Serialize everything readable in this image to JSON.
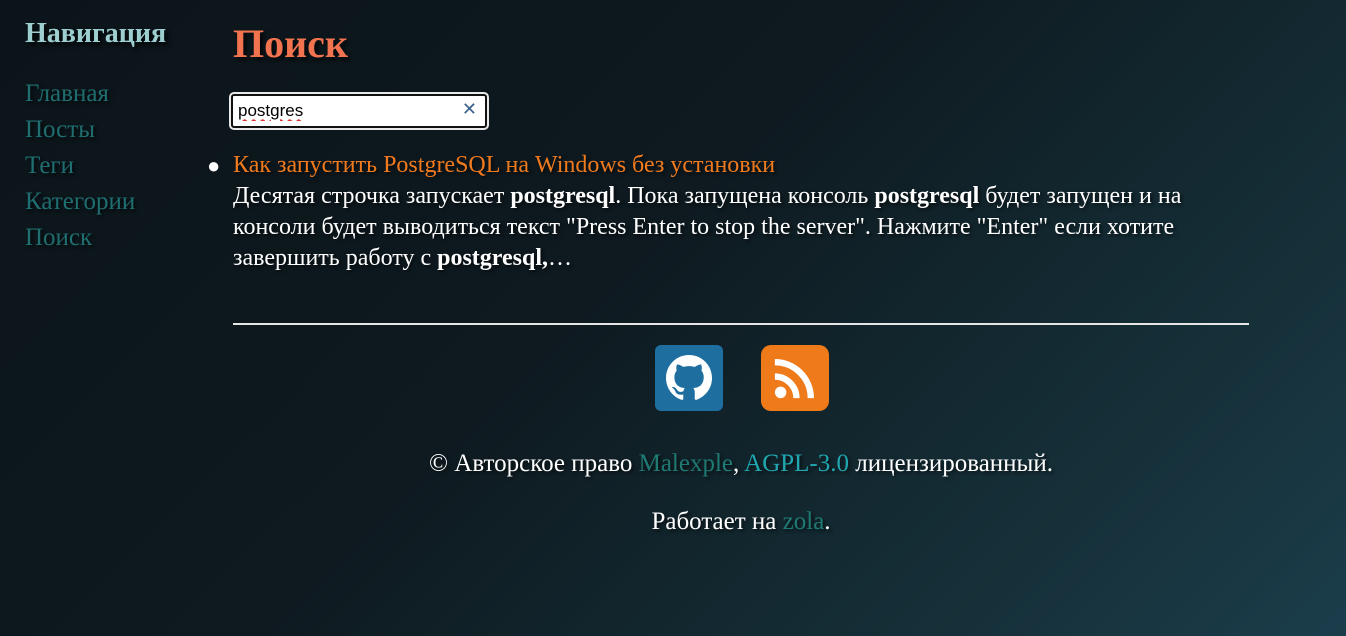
{
  "sidebar": {
    "title": "Навигация",
    "items": [
      {
        "label": "Главная"
      },
      {
        "label": "Посты"
      },
      {
        "label": "Теги"
      },
      {
        "label": "Категории"
      },
      {
        "label": "Поиск"
      }
    ]
  },
  "main": {
    "title": "Поиск",
    "search": {
      "value": "postgres"
    },
    "results": [
      {
        "title": "Как запустить PostgreSQL на Windows без установки",
        "snippet_parts": [
          {
            "text": "Десятая строчка запускает ",
            "bold": false
          },
          {
            "text": "postgresql",
            "bold": true
          },
          {
            "text": ". Пока запущена консоль ",
            "bold": false
          },
          {
            "text": "postgresql",
            "bold": true
          },
          {
            "text": " будет запущен и на консоли будет выводиться текст \"Press Enter to stop the server\". Нажмите \"Enter\" если хотите завершить работу с ",
            "bold": false
          },
          {
            "text": "postgresql,",
            "bold": true
          },
          {
            "text": "…",
            "bold": false
          }
        ]
      }
    ]
  },
  "footer": {
    "icons": [
      "github-icon",
      "rss-icon"
    ],
    "copyright_symbol": "©",
    "copyright_text": " Авторское право ",
    "author": "Malexple",
    "comma": ", ",
    "license": "AGPL-3.0",
    "licensed_text": " лицензированный.",
    "powered_text": "Работает на ",
    "powered_link": "zola",
    "powered_end": "."
  },
  "colors": {
    "accent_title": "#f2734f",
    "link_result": "#f07a1e",
    "nav_link": "#1f6e70",
    "github_bg": "#1f6ea0",
    "rss_bg": "#ef7a1a"
  }
}
